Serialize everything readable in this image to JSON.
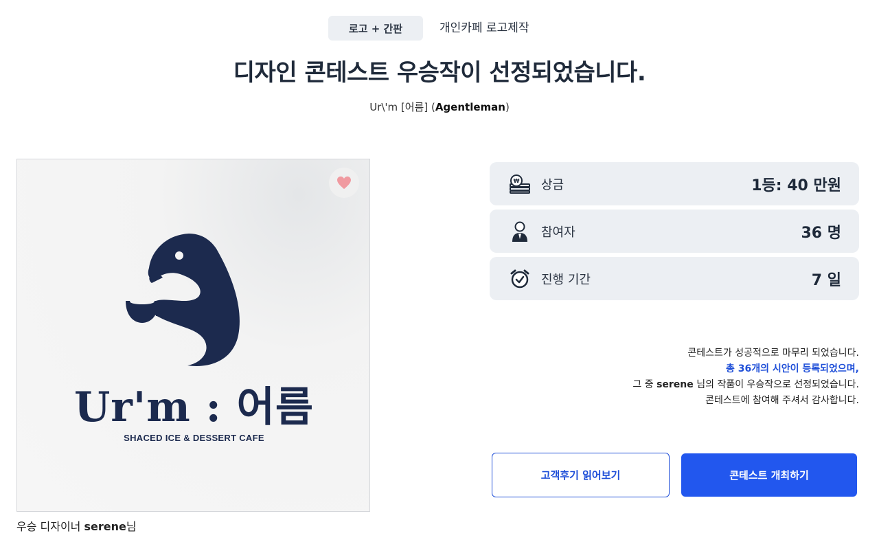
{
  "header": {
    "category_badge": "로고 + 간판",
    "category_sub": "개인카페 로고제작",
    "headline": "디자인 콘테스트 우승작이 선정되었습니다.",
    "project_name": "Ur\\'m [어름]",
    "client_name": "Agentleman"
  },
  "winning_image": {
    "brand_text": "Ur'm : 어름",
    "brand_sub": "SHACED ICE & DESSERT CAFE",
    "like_icon": "heart-icon",
    "brand_color": "#1c2a4e"
  },
  "winner_caption": {
    "prefix": "우승 디자이너",
    "designer": "serene",
    "suffix": "님"
  },
  "stats": [
    {
      "icon": "money-stack-icon",
      "label": "상금",
      "value": "1등: 40 만원"
    },
    {
      "icon": "person-icon",
      "label": "참여자",
      "value": "36 명"
    },
    {
      "icon": "alarm-clock-icon",
      "label": "진행 기간",
      "value": "7 일"
    }
  ],
  "message": {
    "line1": "콘테스트가 성공적으로 마무리 되었습니다.",
    "line2": "총 36개의 시안이 등록되었으며,",
    "line3_prefix": "그 중",
    "line3_designer": "serene",
    "line3_suffix": "님의 작품이 우승작으로 선정되었습니다.",
    "line4": "콘테스트에 참여해 주셔서 감사합니다."
  },
  "buttons": {
    "reviews": "고객후기 읽어보기",
    "host_contest": "콘테스트 개최하기"
  },
  "colors": {
    "accent": "#2257ee",
    "highlight_text": "#1f4fd8",
    "card_bg": "#eceff3",
    "heart": "#f09aa0"
  }
}
